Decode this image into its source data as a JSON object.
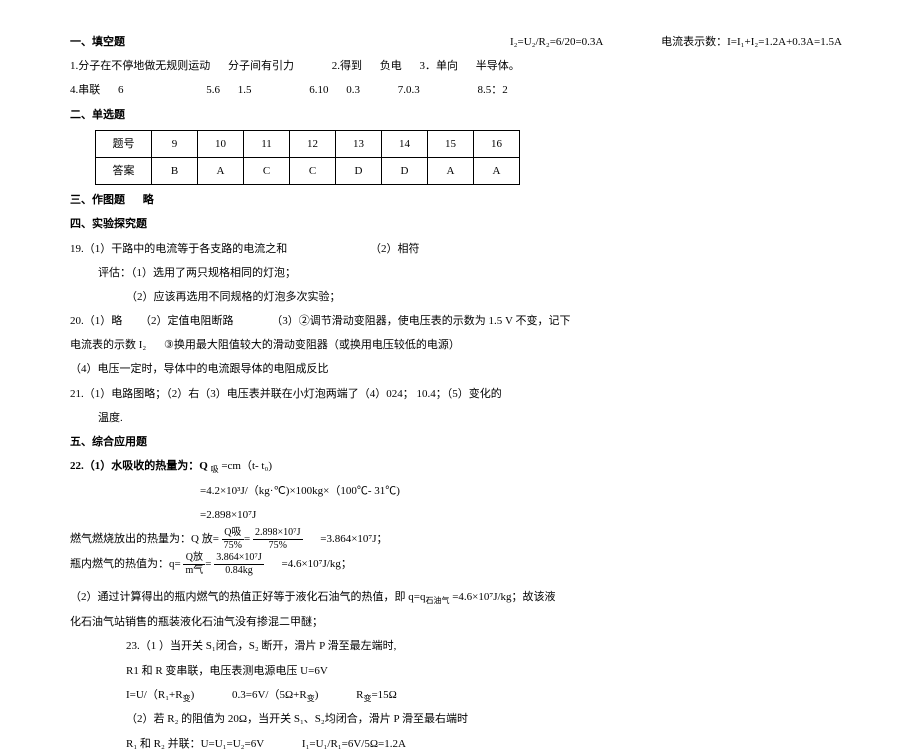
{
  "sec1": {
    "title": "一、填空题",
    "q1": "1.分子在不停地做无规则运动",
    "q1b": "分子间有引力",
    "q1c": "2.得到",
    "q1d": "负电",
    "q1e": "3．单向",
    "q1f": "半导体。",
    "q4a": "4.串联",
    "q4b": "6",
    "q5": "5.6",
    "q5b": "1.5",
    "q6": "6.10",
    "q6b": "0.3",
    "q7": "7.0.3",
    "q8": "8.5：2"
  },
  "sec2": {
    "title": "二、单选题",
    "hrow": "题号",
    "h9": "9",
    "h10": "10",
    "h11": "11",
    "h12": "12",
    "h13": "13",
    "h14": "14",
    "h15": "15",
    "h16": "16",
    "arow": "答案",
    "a9": "B",
    "a10": "A",
    "a11": "C",
    "a12": "C",
    "a13": "D",
    "a14": "D",
    "a15": "A",
    "a16": "A"
  },
  "sec3": {
    "title": "三、作图题",
    "omit": "略"
  },
  "sec4": {
    "title": "四、实验探究题",
    "q19a": "19.（1）干路中的电流等于各支路的电流之和",
    "q19b": "（2）相符",
    "q19c": "评估：（1）选用了两只规格相同的灯泡；",
    "q19d": "（2）应该再选用不同规格的灯泡多次实验；",
    "q20a": "20.（1）略",
    "q20b": "（2）定值电阻断路",
    "q20c": "（3）②调节滑动变阻器，使电压表的示数为 1.5 V 不变，记下",
    "q20d": "电流表的示数 I₂",
    "q20e": "③换用最大阻值较大的滑动变阻器（或换用电压较低的电源）",
    "q20f": "（4）电压一定时，导体中的电流跟导体的电阻成反比",
    "q21a": "21.（1）电路图略；（2）右（3）电压表并联在小灯泡两端了（4）024；",
    "q21b": "10.4；（5）变化的",
    "q21c": "温度."
  },
  "sec5": {
    "title": "五、综合应用题",
    "q22_1": "22.（1）水吸收的热量为：Q ",
    "q22_1b": "=cm（t- t₀)",
    "q22_2a": "=4.2×10³J/（kg·℃)×100kg×（100℃- 31℃)",
    "q22_2b": "=2.898×10⁷J",
    "q22_3a": "燃气燃烧放出的热量为：Q 放=",
    "absorb_lbl": "吸",
    "frac1_top": "Q吸",
    "frac1_val": "2.898×10⁷J",
    "frac1_bot": "75%",
    "frac1_eq": "75%",
    "q22_3b": "=3.864×10⁷J；",
    "q22_4a": "瓶内燃气的热值为：q=",
    "frac2_top": "Q放",
    "frac2_val": "3.864×10⁷J",
    "frac2_bot": "m气",
    "frac2_eq": "0.84kg",
    "q22_4b": "=4.6×10⁷J/kg；",
    "q22_5": "（2）通过计算得出的瓶内燃气的热值正好等于液化石油气的热值，即 q=q",
    "q22_5sub": "石油气",
    "q22_5b": "=4.6×10⁷J/kg；故该液",
    "q22_6": "化石油气站销售的瓶装液化石油气没有掺混二甲醚；",
    "q23_1": "23.（1 ）当开关 S₁闭合，S₂ 断开，滑片 P 滑至最左端时,",
    "q23_2": "R1 和 R 变串联，电压表测电源电压 U=6V",
    "q23_3a": "I=U/（R₁+R",
    "q23_3sub": "变",
    "q23_3b": ")",
    "q23_3c": "0.3=6V/（5Ω+R",
    "q23_3d": ")",
    "q23_3e": "R",
    "q23_3f": "=15Ω",
    "q23_4": "（2）若 R₂ 的阻值为 20Ω，当开关 S₁、S₂均闭合，滑片 P 滑至最右端时",
    "q23_5": "R₁ 和 R₂ 并联：U=U₁=U₂=6V",
    "q23_5b": "I₁=U₁/R₁=6V/5Ω=1.2A"
  },
  "col2": {
    "line1a": "I₂=U₂/R₂=6/20=0.3A",
    "line1b": "电流表示数：I=I₁+I₂=1.2A+0.3A=1.5A"
  }
}
